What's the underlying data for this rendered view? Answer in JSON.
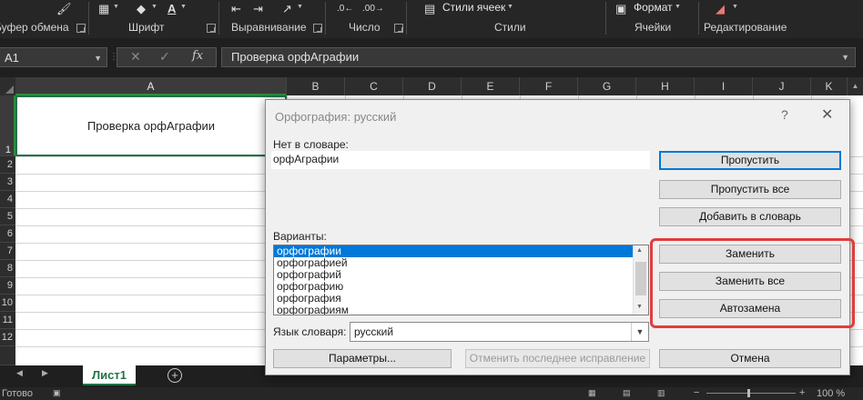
{
  "ribbon": {
    "group_labels": [
      "Буфер обмена",
      "Шрифт",
      "Выравнивание",
      "Число",
      "Стили",
      "Ячейки",
      "Редактирование"
    ],
    "cell_styles_label": "Стили ячеек",
    "format_label": "Формат"
  },
  "formula_bar": {
    "name_box": "A1",
    "fx_symbol": "fx",
    "formula_value": "Проверка орфАграфии"
  },
  "grid": {
    "columns": [
      "A",
      "B",
      "C",
      "D",
      "E",
      "F",
      "G",
      "H",
      "I",
      "J",
      "K"
    ],
    "rows": [
      "1",
      "2",
      "3",
      "4",
      "5",
      "6",
      "7",
      "8",
      "9",
      "10",
      "11",
      "12"
    ],
    "cell_a1": "Проверка орфАграфии"
  },
  "sheet_tabs": {
    "active_tab": "Лист1",
    "add_symbol": "+"
  },
  "status_bar": {
    "status": "Готово",
    "zoom": "100 %"
  },
  "dialog": {
    "title": "Орфография: русский",
    "help": "?",
    "close": "✕",
    "not_in_dict_label": "Нет в словаре:",
    "not_in_dict_value": "орфАграфии",
    "suggestions_label": "Варианты:",
    "suggestions": [
      "орфографии",
      "орфографией",
      "орфографий",
      "орфографию",
      "орфография",
      "орфографиям"
    ],
    "dict_lang_label": "Язык словаря:",
    "dict_lang_value": "русский",
    "buttons": {
      "skip": "Пропустить",
      "skip_all": "Пропустить все",
      "add_to_dict": "Добавить в словарь",
      "replace": "Заменить",
      "replace_all": "Заменить все",
      "autocorrect": "Автозамена",
      "options": "Параметры...",
      "undo_last": "Отменить последнее исправление",
      "cancel": "Отмена"
    }
  },
  "colors": {
    "highlight": "#e03d3d",
    "excel_green": "#217346",
    "selection_blue": "#0078d7"
  }
}
